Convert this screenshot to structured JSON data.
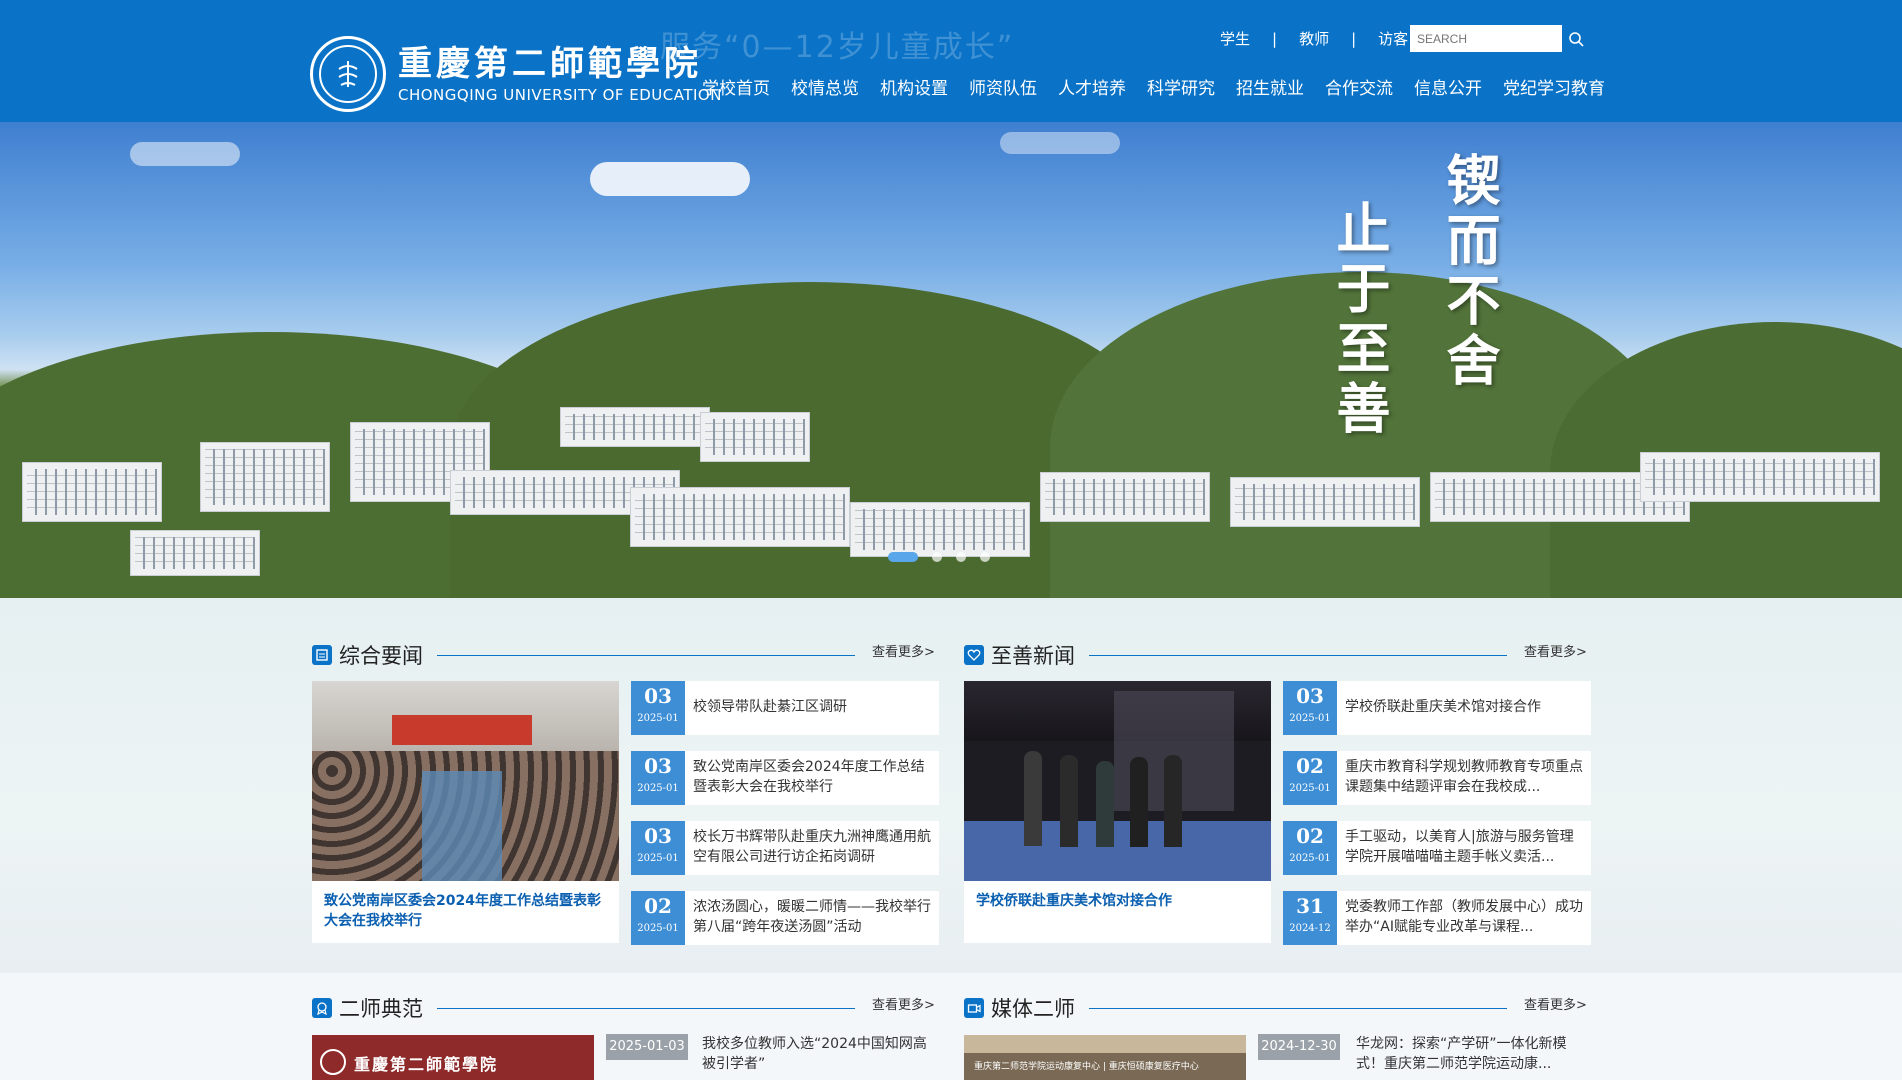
{
  "header": {
    "ghost_text": "服务“0—12岁儿童成长”",
    "logo_cn": "重慶第二師範學院",
    "logo_en": "CHONGQING UNIVERSITY OF EDUCATION",
    "top_links": [
      "学生",
      "教师",
      "访客"
    ],
    "search_placeholder": "SEARCH",
    "nav": [
      "学校首页",
      "校情总览",
      "机构设置",
      "师资队伍",
      "人才培养",
      "科学研究",
      "招生就业",
      "合作交流",
      "信息公开",
      "党纪学习教育"
    ],
    "color": "#0a73c7"
  },
  "banner": {
    "motto_right": "锲而不舍",
    "motto_left": "止于至善"
  },
  "news": {
    "title": "综合要闻",
    "more": "查看更多>",
    "feature_caption": "致公党南岸区委会2024年度工作总结暨表彰大会在我校举行",
    "items": [
      {
        "day": "03",
        "ym": "2025-01",
        "title": "校领导带队赴綦江区调研"
      },
      {
        "day": "03",
        "ym": "2025-01",
        "title": "致公党南岸区委会2024年度工作总结暨表彰大会在我校举行"
      },
      {
        "day": "03",
        "ym": "2025-01",
        "title": "校长万书辉带队赴重庆九洲神鹰通用航空有限公司进行访企拓岗调研"
      },
      {
        "day": "02",
        "ym": "2025-01",
        "title": "浓浓汤圆心，暖暖二师情——我校举行第八届“跨年夜送汤圆”活动"
      }
    ]
  },
  "zhishan": {
    "title": "至善新闻",
    "more": "查看更多>",
    "feature_caption": "学校侨联赴重庆美术馆对接合作",
    "items": [
      {
        "day": "03",
        "ym": "2025-01",
        "title": "学校侨联赴重庆美术馆对接合作"
      },
      {
        "day": "02",
        "ym": "2025-01",
        "title": "重庆市教育科学规划教师教育专项重点课题集中结题评审会在我校成..."
      },
      {
        "day": "02",
        "ym": "2025-01",
        "title": "手工驱动，以美育人|旅游与服务管理学院开展喵喵喵主题手帐义卖活..."
      },
      {
        "day": "31",
        "ym": "2024-12",
        "title": "党委教师工作部（教师发展中心）成功举办“AI赋能专业改革与课程..."
      }
    ]
  },
  "ershi": {
    "title": "二师典范",
    "more": "查看更多>",
    "date": "2025-01-03",
    "item_title": "我校多位教师入选“2024中国知网高被引学者”",
    "thumb_text": "重慶第二師範學院"
  },
  "media": {
    "title": "媒体二师",
    "more": "查看更多>",
    "date": "2024-12-30",
    "item_title": "华龙网：探索“产学研”一体化新模式！重庆第二师范学院运动康...",
    "thumb_text": "重庆第二师范学院运动康复中心 | 重庆恒硕康复医疗中心"
  }
}
